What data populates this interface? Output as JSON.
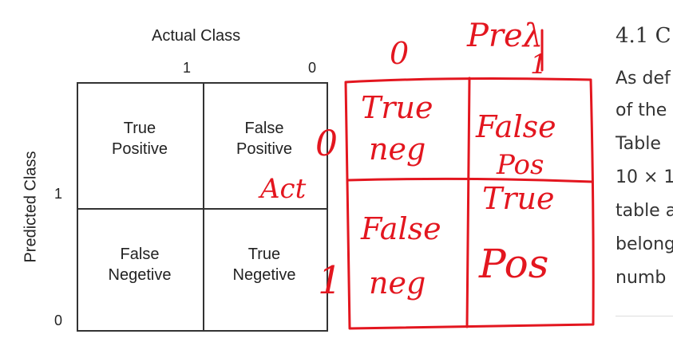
{
  "matrix": {
    "x_axis_title": "Actual Class",
    "x_ticks": [
      "1",
      "0"
    ],
    "y_axis_title": "Predicted Class",
    "y_ticks": [
      "1",
      "0"
    ],
    "cells": [
      {
        "line1": "True",
        "line2": "Positive"
      },
      {
        "line1": "False",
        "line2": "Positive"
      },
      {
        "line1": "False",
        "line2": "Negetive"
      },
      {
        "line1": "True",
        "line2": "Negetive"
      }
    ]
  },
  "handwriting": {
    "color": "#e3161f",
    "top_title": "Preλ",
    "col_zero": "0",
    "col_one": "1",
    "row_zero": "0",
    "row_label": "Act",
    "row_one": "1",
    "cells": [
      {
        "line1": "True",
        "line2": "neg"
      },
      {
        "line1": "False",
        "line2": "Pos"
      },
      {
        "line1": "False",
        "line2": "neg"
      },
      {
        "line1": "True",
        "line2": "Pos"
      }
    ]
  },
  "right_text": {
    "heading": "4.1 C",
    "lines": [
      "As def",
      "of the",
      "Table",
      "10 × 1",
      "table a",
      "belong",
      "numb"
    ]
  }
}
